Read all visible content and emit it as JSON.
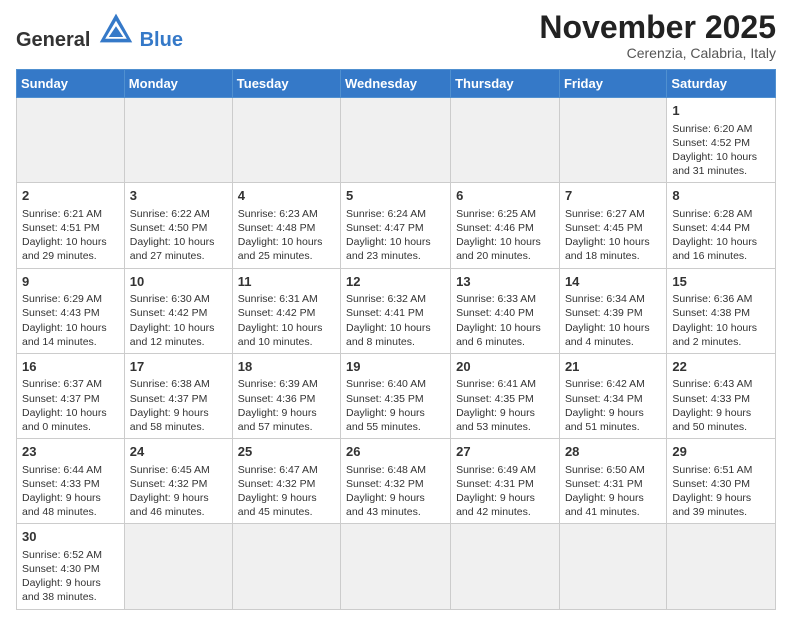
{
  "header": {
    "logo_general": "General",
    "logo_blue": "Blue",
    "month": "November 2025",
    "location": "Cerenzia, Calabria, Italy"
  },
  "weekdays": [
    "Sunday",
    "Monday",
    "Tuesday",
    "Wednesday",
    "Thursday",
    "Friday",
    "Saturday"
  ],
  "weeks": [
    [
      {
        "day": "",
        "empty": true
      },
      {
        "day": "",
        "empty": true
      },
      {
        "day": "",
        "empty": true
      },
      {
        "day": "",
        "empty": true
      },
      {
        "day": "",
        "empty": true
      },
      {
        "day": "",
        "empty": true
      },
      {
        "day": "1",
        "sunrise": "6:20 AM",
        "sunset": "4:52 PM",
        "daylight": "10 hours and 31 minutes."
      }
    ],
    [
      {
        "day": "2",
        "sunrise": "6:21 AM",
        "sunset": "4:51 PM",
        "daylight": "10 hours and 29 minutes."
      },
      {
        "day": "3",
        "sunrise": "6:22 AM",
        "sunset": "4:50 PM",
        "daylight": "10 hours and 27 minutes."
      },
      {
        "day": "4",
        "sunrise": "6:23 AM",
        "sunset": "4:48 PM",
        "daylight": "10 hours and 25 minutes."
      },
      {
        "day": "5",
        "sunrise": "6:24 AM",
        "sunset": "4:47 PM",
        "daylight": "10 hours and 23 minutes."
      },
      {
        "day": "6",
        "sunrise": "6:25 AM",
        "sunset": "4:46 PM",
        "daylight": "10 hours and 20 minutes."
      },
      {
        "day": "7",
        "sunrise": "6:27 AM",
        "sunset": "4:45 PM",
        "daylight": "10 hours and 18 minutes."
      },
      {
        "day": "8",
        "sunrise": "6:28 AM",
        "sunset": "4:44 PM",
        "daylight": "10 hours and 16 minutes."
      }
    ],
    [
      {
        "day": "9",
        "sunrise": "6:29 AM",
        "sunset": "4:43 PM",
        "daylight": "10 hours and 14 minutes."
      },
      {
        "day": "10",
        "sunrise": "6:30 AM",
        "sunset": "4:42 PM",
        "daylight": "10 hours and 12 minutes."
      },
      {
        "day": "11",
        "sunrise": "6:31 AM",
        "sunset": "4:42 PM",
        "daylight": "10 hours and 10 minutes."
      },
      {
        "day": "12",
        "sunrise": "6:32 AM",
        "sunset": "4:41 PM",
        "daylight": "10 hours and 8 minutes."
      },
      {
        "day": "13",
        "sunrise": "6:33 AM",
        "sunset": "4:40 PM",
        "daylight": "10 hours and 6 minutes."
      },
      {
        "day": "14",
        "sunrise": "6:34 AM",
        "sunset": "4:39 PM",
        "daylight": "10 hours and 4 minutes."
      },
      {
        "day": "15",
        "sunrise": "6:36 AM",
        "sunset": "4:38 PM",
        "daylight": "10 hours and 2 minutes."
      }
    ],
    [
      {
        "day": "16",
        "sunrise": "6:37 AM",
        "sunset": "4:37 PM",
        "daylight": "10 hours and 0 minutes."
      },
      {
        "day": "17",
        "sunrise": "6:38 AM",
        "sunset": "4:37 PM",
        "daylight": "9 hours and 58 minutes."
      },
      {
        "day": "18",
        "sunrise": "6:39 AM",
        "sunset": "4:36 PM",
        "daylight": "9 hours and 57 minutes."
      },
      {
        "day": "19",
        "sunrise": "6:40 AM",
        "sunset": "4:35 PM",
        "daylight": "9 hours and 55 minutes."
      },
      {
        "day": "20",
        "sunrise": "6:41 AM",
        "sunset": "4:35 PM",
        "daylight": "9 hours and 53 minutes."
      },
      {
        "day": "21",
        "sunrise": "6:42 AM",
        "sunset": "4:34 PM",
        "daylight": "9 hours and 51 minutes."
      },
      {
        "day": "22",
        "sunrise": "6:43 AM",
        "sunset": "4:33 PM",
        "daylight": "9 hours and 50 minutes."
      }
    ],
    [
      {
        "day": "23",
        "sunrise": "6:44 AM",
        "sunset": "4:33 PM",
        "daylight": "9 hours and 48 minutes."
      },
      {
        "day": "24",
        "sunrise": "6:45 AM",
        "sunset": "4:32 PM",
        "daylight": "9 hours and 46 minutes."
      },
      {
        "day": "25",
        "sunrise": "6:47 AM",
        "sunset": "4:32 PM",
        "daylight": "9 hours and 45 minutes."
      },
      {
        "day": "26",
        "sunrise": "6:48 AM",
        "sunset": "4:32 PM",
        "daylight": "9 hours and 43 minutes."
      },
      {
        "day": "27",
        "sunrise": "6:49 AM",
        "sunset": "4:31 PM",
        "daylight": "9 hours and 42 minutes."
      },
      {
        "day": "28",
        "sunrise": "6:50 AM",
        "sunset": "4:31 PM",
        "daylight": "9 hours and 41 minutes."
      },
      {
        "day": "29",
        "sunrise": "6:51 AM",
        "sunset": "4:30 PM",
        "daylight": "9 hours and 39 minutes."
      }
    ],
    [
      {
        "day": "30",
        "sunrise": "6:52 AM",
        "sunset": "4:30 PM",
        "daylight": "9 hours and 38 minutes."
      },
      {
        "day": "",
        "empty": true
      },
      {
        "day": "",
        "empty": true
      },
      {
        "day": "",
        "empty": true
      },
      {
        "day": "",
        "empty": true
      },
      {
        "day": "",
        "empty": true
      },
      {
        "day": "",
        "empty": true
      }
    ]
  ]
}
